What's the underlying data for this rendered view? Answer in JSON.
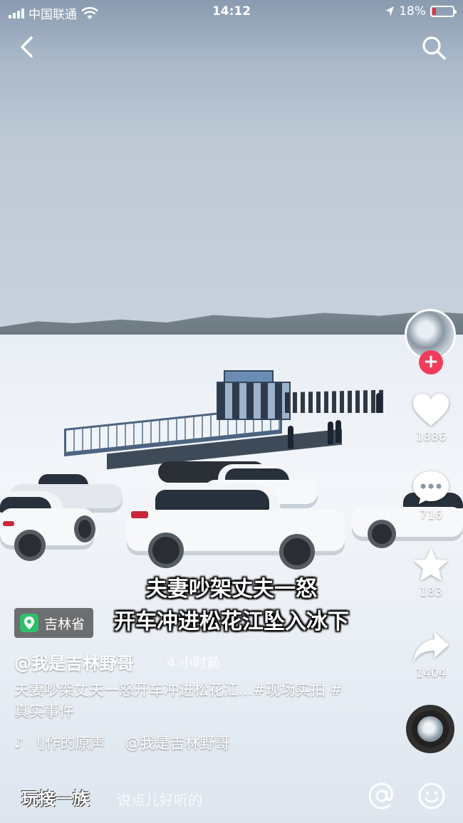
{
  "status": {
    "carrier": "中国联通",
    "time": "14:12",
    "battery": "18%"
  },
  "caption": {
    "line1": "夫妻吵架丈夫一怒",
    "line2": "开车冲进松花江坠入冰下"
  },
  "location": "吉林省",
  "author": "@我是吉林野哥",
  "time_ago": "· 4 小时前",
  "description": "夫妻吵架丈夫一怒开车冲进松花江...#现场实拍 #真实事件",
  "music": "刂作的原声　 @我是吉林野哥",
  "actions": {
    "likes": "1886",
    "comments": "716",
    "favorites": "183",
    "shares": "1404"
  },
  "comment_bar": {
    "watermark": "玩接一族",
    "placeholder": "说点儿好听的"
  },
  "colors": {
    "follow": "#f23c5c",
    "location_pin": "#2fbf6a",
    "battery_low": "#e8333d"
  },
  "icons": [
    "back-icon",
    "search-icon",
    "heart-icon",
    "comment-icon",
    "star-icon",
    "share-icon",
    "at-icon",
    "emoji-icon",
    "music-note-icon",
    "location-pin-icon",
    "plus-icon"
  ]
}
